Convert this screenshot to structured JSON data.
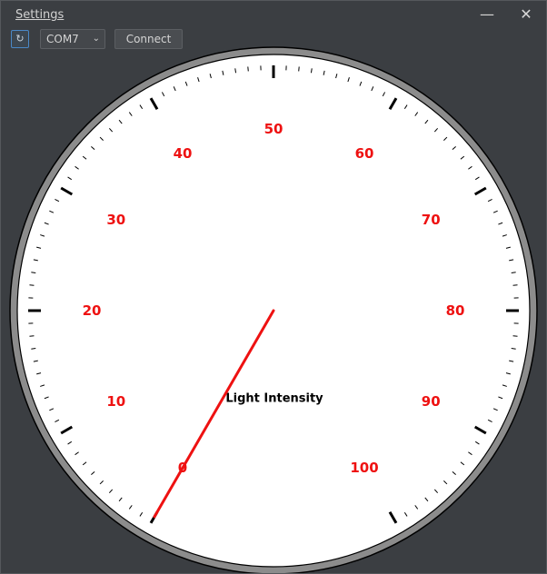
{
  "menu": {
    "settings_label": "Settings"
  },
  "window_controls": {
    "minimize": "—",
    "close": "✕"
  },
  "toolbar": {
    "refresh_icon": "refresh-icon",
    "refresh_glyph": "↻",
    "port_value": "COM7",
    "connect_label": "Connect"
  },
  "gauge": {
    "title": "Light Intensity",
    "min": 0,
    "max": 100,
    "value": 0,
    "major_labels": [
      "0",
      "10",
      "20",
      "30",
      "40",
      "50",
      "60",
      "70",
      "80",
      "90",
      "100"
    ],
    "label_color": "#ee1111",
    "needle_color": "#ee1111",
    "face_color": "#ffffff",
    "tick_color": "#000000",
    "rim_color": "#8c8c8c"
  }
}
